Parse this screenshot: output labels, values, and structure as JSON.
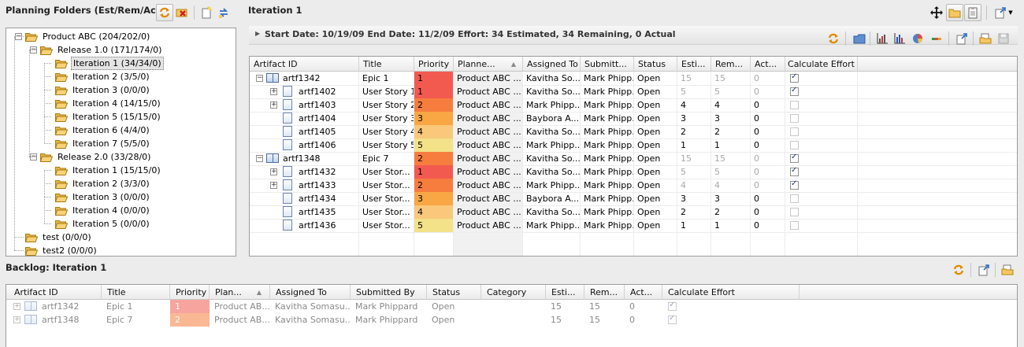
{
  "left_panel": {
    "title": "Planning Folders (Est/Rem/Act)",
    "tree": [
      {
        "label": "Product ABC (204/202/0)",
        "level": 0,
        "expanded": true
      },
      {
        "label": "Release 1.0 (171/174/0)",
        "level": 1,
        "expanded": true
      },
      {
        "label": "Iteration 1 (34/34/0)",
        "level": 2,
        "selected": true
      },
      {
        "label": "Iteration 2 (3/5/0)",
        "level": 2
      },
      {
        "label": "Iteration 3 (0/0/0)",
        "level": 2
      },
      {
        "label": "Iteration 4 (14/15/0)",
        "level": 2
      },
      {
        "label": "Iteration 5 (15/15/0)",
        "level": 2
      },
      {
        "label": "Iteration 6 (4/4/0)",
        "level": 2
      },
      {
        "label": "Iteration 7 (5/5/0)",
        "level": 2
      },
      {
        "label": "Release 2.0 (33/28/0)",
        "level": 1,
        "expanded": true
      },
      {
        "label": "Iteration 1 (15/15/0)",
        "level": 2
      },
      {
        "label": "Iteration 2 (3/3/0)",
        "level": 2
      },
      {
        "label": "Iteration 3 (0/0/0)",
        "level": 2
      },
      {
        "label": "Iteration 4 (0/0/0)",
        "level": 2
      },
      {
        "label": "Iteration 5 (0/0/0)",
        "level": 2
      },
      {
        "label": "test (0/0/0)",
        "level": 0
      },
      {
        "label": "test2 (0/0/0)",
        "level": 0
      }
    ]
  },
  "main_panel": {
    "title": "Iteration 1",
    "info": "Start Date: 10/19/09  End Date: 11/2/09  Effort: 34 Estimated, 34 Remaining, 0 Actual",
    "columns": [
      "Artifact ID",
      "Title",
      "Priority",
      "Planne...",
      "Assigned To",
      "Submitt...",
      "Status",
      "Esti...",
      "Rem...",
      "Act...",
      "Calculate Effort"
    ],
    "rows": [
      {
        "id": "artf1342",
        "title": "Epic 1",
        "priority": "1",
        "planned": "Product ABC ...",
        "assigned": "Kavitha So...",
        "submitted": "Mark Phipp...",
        "status": "Open",
        "est": "15",
        "rem": "15",
        "act": "0",
        "calc": true,
        "level": 0,
        "icon": "book",
        "expander": "minus",
        "dim": true
      },
      {
        "id": "artf1402",
        "title": "User Story 1",
        "priority": "1",
        "planned": "Product ABC ...",
        "assigned": "Kavitha So...",
        "submitted": "Mark Phipp...",
        "status": "Open",
        "est": "5",
        "rem": "5",
        "act": "0",
        "calc": true,
        "level": 1,
        "icon": "doc",
        "expander": "plus",
        "dim": true
      },
      {
        "id": "artf1403",
        "title": "User Story 2",
        "priority": "2",
        "planned": "Product ABC ...",
        "assigned": "Mark Phipp...",
        "submitted": "Mark Phipp...",
        "status": "Open",
        "est": "4",
        "rem": "4",
        "act": "0",
        "calc": false,
        "level": 1,
        "icon": "doc",
        "expander": "plus",
        "dim": false
      },
      {
        "id": "artf1404",
        "title": "User Story 3",
        "priority": "3",
        "planned": "Product ABC ...",
        "assigned": "Baybora A...",
        "submitted": "Mark Phipp...",
        "status": "Open",
        "est": "3",
        "rem": "3",
        "act": "0",
        "calc": false,
        "level": 1,
        "icon": "doc",
        "expander": "",
        "dim": false
      },
      {
        "id": "artf1405",
        "title": "User Story 4",
        "priority": "4",
        "planned": "Product ABC ...",
        "assigned": "Kavitha So...",
        "submitted": "Mark Phipp...",
        "status": "Open",
        "est": "2",
        "rem": "2",
        "act": "0",
        "calc": false,
        "level": 1,
        "icon": "doc",
        "expander": "",
        "dim": false
      },
      {
        "id": "artf1406",
        "title": "User Story 5",
        "priority": "5",
        "planned": "Product ABC ...",
        "assigned": "Mark Phipp...",
        "submitted": "Mark Phipp...",
        "status": "Open",
        "est": "1",
        "rem": "1",
        "act": "0",
        "calc": false,
        "level": 1,
        "icon": "doc",
        "expander": "",
        "dim": false
      },
      {
        "id": "artf1348",
        "title": "Epic 7",
        "priority": "2",
        "planned": "Product ABC ...",
        "assigned": "Kavitha So...",
        "submitted": "Mark Phipp...",
        "status": "Open",
        "est": "15",
        "rem": "15",
        "act": "0",
        "calc": true,
        "level": 0,
        "icon": "book",
        "expander": "minus",
        "dim": true
      },
      {
        "id": "artf1432",
        "title": "User Stor...",
        "priority": "1",
        "planned": "Product ABC ...",
        "assigned": "Kavitha So...",
        "submitted": "Mark Phipp...",
        "status": "Open",
        "est": "5",
        "rem": "5",
        "act": "0",
        "calc": true,
        "level": 1,
        "icon": "doc",
        "expander": "plus",
        "dim": true
      },
      {
        "id": "artf1433",
        "title": "User Stor...",
        "priority": "2",
        "planned": "Product ABC ...",
        "assigned": "Mark Phipp...",
        "submitted": "Mark Phipp...",
        "status": "Open",
        "est": "4",
        "rem": "4",
        "act": "0",
        "calc": true,
        "level": 1,
        "icon": "doc",
        "expander": "plus",
        "dim": true
      },
      {
        "id": "artf1434",
        "title": "User Stor...",
        "priority": "3",
        "planned": "Product ABC ...",
        "assigned": "Baybora A...",
        "submitted": "Mark Phipp...",
        "status": "Open",
        "est": "3",
        "rem": "3",
        "act": "0",
        "calc": false,
        "level": 1,
        "icon": "doc",
        "expander": "",
        "dim": false
      },
      {
        "id": "artf1435",
        "title": "User Stor...",
        "priority": "4",
        "planned": "Product ABC ...",
        "assigned": "Kavitha So...",
        "submitted": "Mark Phipp...",
        "status": "Open",
        "est": "2",
        "rem": "2",
        "act": "0",
        "calc": false,
        "level": 1,
        "icon": "doc",
        "expander": "",
        "dim": false
      },
      {
        "id": "artf1436",
        "title": "User Stor...",
        "priority": "5",
        "planned": "Product ABC ...",
        "assigned": "Mark Phipp...",
        "submitted": "Mark Phipp...",
        "status": "Open",
        "est": "1",
        "rem": "1",
        "act": "0",
        "calc": false,
        "level": 1,
        "icon": "doc",
        "expander": "",
        "dim": false
      }
    ]
  },
  "priority_colors": {
    "1": "#f25a4f",
    "2": "#f77d3e",
    "3": "#f8a744",
    "4": "#f9c87a",
    "5": "#f3e287"
  },
  "backlog": {
    "title": "Backlog: Iteration 1",
    "columns": [
      "Artifact ID",
      "Title",
      "Priority",
      "Plan...",
      "Assigned To",
      "Submitted By",
      "Status",
      "Category",
      "Esti...",
      "Rem...",
      "Act...",
      "Calculate Effort"
    ],
    "rows": [
      {
        "id": "artf1342",
        "title": "Epic 1",
        "priority": "1",
        "planned": "Product AB...",
        "assigned": "Kavitha Somasu...",
        "submitted": "Mark Phippard",
        "status": "Open",
        "category": "",
        "est": "15",
        "rem": "15",
        "act": "0",
        "calc": true
      },
      {
        "id": "artf1348",
        "title": "Epic 7",
        "priority": "2",
        "planned": "Product AB...",
        "assigned": "Kavitha Somasu...",
        "submitted": "Mark Phippard",
        "status": "Open",
        "category": "",
        "est": "15",
        "rem": "15",
        "act": "0",
        "calc": true
      }
    ]
  },
  "icons": {
    "toolbar_left": [
      "refresh-icon",
      "delete-folder-icon",
      "new-folder-icon",
      "move-icon"
    ],
    "toolbar_main_top": [
      "move-arrows-icon",
      "folder-icon",
      "clipboard-icon",
      "export-icon"
    ],
    "toolbar_grid": [
      "refresh-icon",
      "folder-blue-icon",
      "bar-chart-icon",
      "bar-chart-colored-icon",
      "pie-chart-icon",
      "burndown-icon",
      "export-icon",
      "open-folder-icon",
      "save-icon"
    ],
    "toolbar_backlog": [
      "refresh-icon",
      "export-icon",
      "open-folder-icon"
    ]
  }
}
